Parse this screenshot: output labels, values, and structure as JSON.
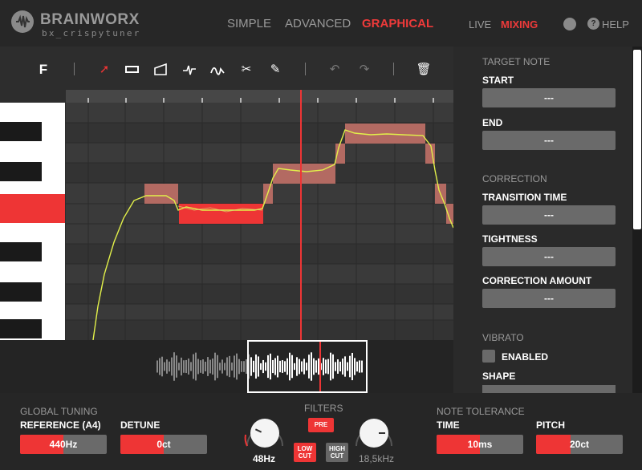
{
  "header": {
    "brand": "BRAINWORX",
    "product": "bx_crispytuner",
    "modes": [
      "SIMPLE",
      "ADVANCED",
      "GRAPHICAL"
    ],
    "active_mode": "GRAPHICAL",
    "live": "LIVE",
    "mixing": "MIXING",
    "help": "HELP"
  },
  "toolbar": {
    "format_label": "F",
    "tools": [
      "select-arrow",
      "rectangle",
      "ramp",
      "pitch-tool",
      "vibrato",
      "scissors",
      "pen"
    ],
    "undo": "undo",
    "redo": "redo",
    "trash": "delete"
  },
  "zoom": {
    "plus": "+",
    "minus": "−"
  },
  "panel": {
    "target_note": {
      "title": "TARGET NOTE",
      "start_label": "START",
      "start_value": "---",
      "end_label": "END",
      "end_value": "---"
    },
    "correction": {
      "title": "CORRECTION",
      "transition_label": "TRANSITION TIME",
      "transition_value": "---",
      "tightness_label": "TIGHTNESS",
      "tightness_value": "---",
      "amount_label": "CORRECTION AMOUNT",
      "amount_value": "---"
    },
    "vibrato": {
      "title": "VIBRATO",
      "enabled_label": "ENABLED",
      "enabled": false,
      "shape_label": "SHAPE"
    }
  },
  "footer": {
    "global_tuning": "GLOBAL TUNING",
    "reference": {
      "label": "REFERENCE (A4)",
      "value": "440Hz",
      "fill": 0.5
    },
    "detune": {
      "label": "DETUNE",
      "value": "0ct",
      "fill": 0.5
    },
    "filters": {
      "title": "FILTERS",
      "pre": "PRE",
      "low_cut": "LOW CUT",
      "high_cut": "HIGH CUT",
      "low_value": "48Hz",
      "high_value": "18,5kHz"
    },
    "note_tolerance": "NOTE TOLERANCE",
    "time": {
      "label": "TIME",
      "value": "10ms",
      "fill": 0.5
    },
    "pitch": {
      "label": "PITCH",
      "value": "20ct",
      "fill": 0.5
    }
  },
  "colors": {
    "accent": "#ee3535",
    "bg": "#262626"
  }
}
